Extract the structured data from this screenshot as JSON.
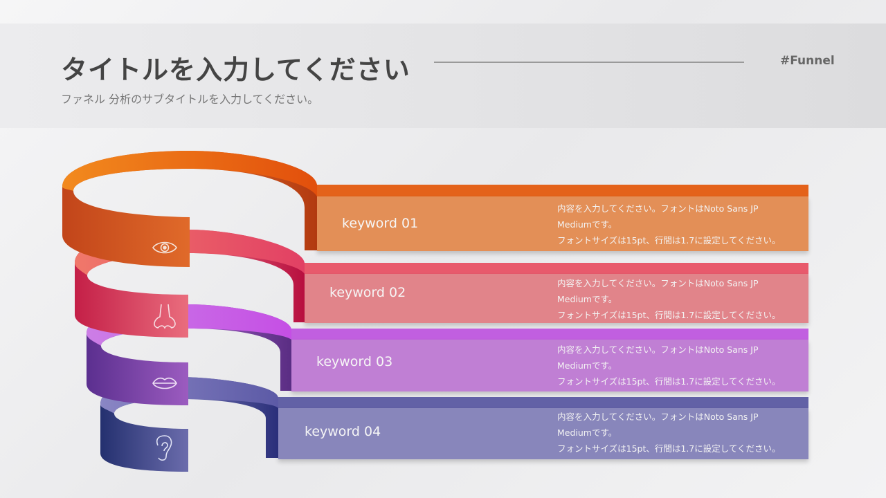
{
  "header": {
    "title": "タイトルを入力してください",
    "subtitle": "ファネル 分析のサブタイトルを入力してください。",
    "tag": "#Funnel"
  },
  "stages": [
    {
      "keyword": "keyword 01",
      "icon": "eye-icon",
      "color_dark": "#e4621a",
      "color_light": "#e38f57",
      "description": [
        "内容を入力してください。フォントはNoto Sans JP",
        "Mediumです。",
        "フォントサイズは15pt、行間は1.7に設定してください。"
      ]
    },
    {
      "keyword": "keyword 02",
      "icon": "nose-icon",
      "color_dark": "#e85a6c",
      "color_light": "#e1848a",
      "description": [
        "内容を入力してください。フォントはNoto Sans JP",
        "Mediumです。",
        "フォントサイズは15pt、行間は1.7に設定してください。"
      ]
    },
    {
      "keyword": "keyword 03",
      "icon": "lips-icon",
      "color_dark": "#c15fe0",
      "color_light": "#c07fd4",
      "description": [
        "内容を入力してください。フォントはNoto Sans JP",
        "Mediumです。",
        "フォントサイズは15pt、行間は1.7に設定してください。"
      ]
    },
    {
      "keyword": "keyword 04",
      "icon": "ear-icon",
      "color_dark": "#6261a6",
      "color_light": "#8886bb",
      "description": [
        "内容を入力してください。フォントはNoto Sans JP",
        "Mediumです。",
        "フォントサイズは15pt、行間は1.7に設定してください。"
      ]
    }
  ]
}
